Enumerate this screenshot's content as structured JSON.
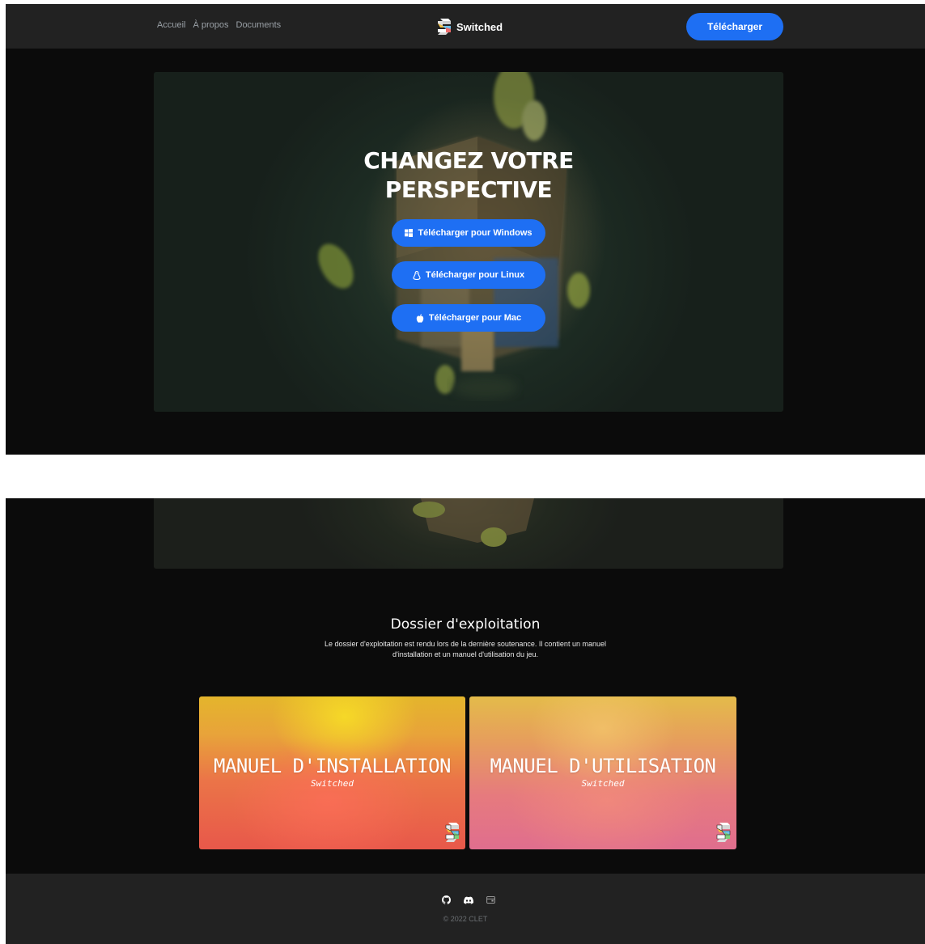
{
  "nav": {
    "links": [
      "Accueil",
      "À propos",
      "Documents"
    ],
    "brand": "Switched",
    "download_label": "Télécharger"
  },
  "hero": {
    "title_line1": "CHANGEZ VOTRE",
    "title_line2": "PERSPECTIVE",
    "buttons": [
      {
        "label": "Télécharger pour Windows",
        "icon": "windows-icon"
      },
      {
        "label": "Télécharger pour Linux",
        "icon": "linux-icon"
      },
      {
        "label": "Télécharger pour Mac",
        "icon": "apple-icon"
      }
    ]
  },
  "docs": {
    "title": "Dossier d'exploitation",
    "description": "Le dossier d'exploitation est rendu lors de la dernière soutenance. Il contient un manuel d'installation et un manuel d'utilisation du jeu.",
    "cards": [
      {
        "title": "MANUEL D'INSTALLATION",
        "subtitle": "Switched"
      },
      {
        "title": "MANUEL D'UTILISATION",
        "subtitle": "Switched"
      }
    ]
  },
  "footer": {
    "icons": [
      "github-icon",
      "discord-icon",
      "itchio-icon"
    ],
    "copyright": "© 2022 CLET"
  },
  "colors": {
    "accent": "#1e6ff3",
    "nav_bg": "#222222",
    "page_bg": "#0b0b0b"
  }
}
